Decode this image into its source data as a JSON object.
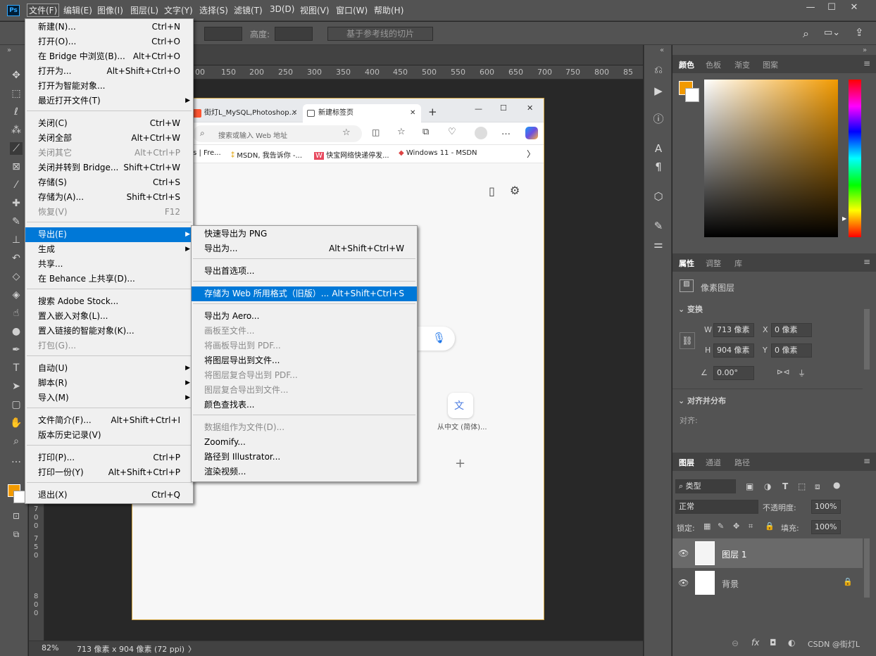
{
  "menubar": {
    "items": [
      "文件(F)",
      "编辑(E)",
      "图像(I)",
      "图层(L)",
      "文字(Y)",
      "选择(S)",
      "滤镜(T)",
      "3D(D)",
      "视图(V)",
      "窗口(W)",
      "帮助(H)"
    ],
    "win_min": "—",
    "win_max": "☐",
    "win_close": "✕"
  },
  "optbar": {
    "height_label": "高度:",
    "slice_btn": "基于参考线的切片"
  },
  "ruler": {
    "top": [
      "00",
      "150",
      "200",
      "250",
      "300",
      "350",
      "400",
      "450",
      "500",
      "550",
      "600",
      "650",
      "700",
      "750",
      "800",
      "85"
    ],
    "left": [
      "7",
      "0",
      "0",
      "7",
      "5",
      "0",
      "8",
      "0",
      "0"
    ]
  },
  "browser": {
    "tab1": "街灯L_MySQL,Photoshop...",
    "tab2": "新建标签页",
    "address_placeholder": "搜索或输入 Web 地址",
    "favs": [
      "rs | Fre...",
      "MSDN, 我告诉你 -...",
      "快宝网络快递停发...",
      "Windows 11 - MSDN"
    ],
    "translate_label": "从中文 (简体)...",
    "plus": "+",
    "win_min": "—",
    "win_max": "☐",
    "win_close": "✕"
  },
  "status": {
    "zoom": "82%",
    "doc_info": "713 像素 x 904 像素 (72 ppi)",
    "arrow": "〉"
  },
  "file_menu": {
    "items": [
      {
        "label": "新建(N)...",
        "shortcut": "Ctrl+N"
      },
      {
        "label": "打开(O)...",
        "shortcut": "Ctrl+O"
      },
      {
        "label": "在 Bridge 中浏览(B)...",
        "shortcut": "Alt+Ctrl+O"
      },
      {
        "label": "打开为...",
        "shortcut": "Alt+Shift+Ctrl+O"
      },
      {
        "label": "打开为智能对象...",
        "shortcut": ""
      },
      {
        "label": "最近打开文件(T)",
        "shortcut": ""
      },
      {
        "label": "关闭(C)",
        "shortcut": "Ctrl+W"
      },
      {
        "label": "关闭全部",
        "shortcut": "Alt+Ctrl+W"
      },
      {
        "label": "关闭其它",
        "shortcut": "Alt+Ctrl+P"
      },
      {
        "label": "关闭并转到 Bridge...",
        "shortcut": "Shift+Ctrl+W"
      },
      {
        "label": "存储(S)",
        "shortcut": "Ctrl+S"
      },
      {
        "label": "存储为(A)...",
        "shortcut": "Shift+Ctrl+S"
      },
      {
        "label": "恢复(V)",
        "shortcut": "F12"
      },
      {
        "label": "导出(E)",
        "shortcut": ""
      },
      {
        "label": "生成",
        "shortcut": ""
      },
      {
        "label": "共享...",
        "shortcut": ""
      },
      {
        "label": "在 Behance 上共享(D)...",
        "shortcut": ""
      },
      {
        "label": "搜索 Adobe Stock...",
        "shortcut": ""
      },
      {
        "label": "置入嵌入对象(L)...",
        "shortcut": ""
      },
      {
        "label": "置入链接的智能对象(K)...",
        "shortcut": ""
      },
      {
        "label": "打包(G)...",
        "shortcut": ""
      },
      {
        "label": "自动(U)",
        "shortcut": ""
      },
      {
        "label": "脚本(R)",
        "shortcut": ""
      },
      {
        "label": "导入(M)",
        "shortcut": ""
      },
      {
        "label": "文件简介(F)...",
        "shortcut": "Alt+Shift+Ctrl+I"
      },
      {
        "label": "版本历史记录(V)",
        "shortcut": ""
      },
      {
        "label": "打印(P)...",
        "shortcut": "Ctrl+P"
      },
      {
        "label": "打印一份(Y)",
        "shortcut": "Alt+Shift+Ctrl+P"
      },
      {
        "label": "退出(X)",
        "shortcut": "Ctrl+Q"
      }
    ]
  },
  "export_menu": {
    "items": [
      {
        "label": "快速导出为 PNG",
        "shortcut": ""
      },
      {
        "label": "导出为...",
        "shortcut": "Alt+Shift+Ctrl+W"
      },
      {
        "label": "导出首选项...",
        "shortcut": ""
      },
      {
        "label": "存储为 Web 所用格式（旧版）...",
        "shortcut": "Alt+Shift+Ctrl+S"
      },
      {
        "label": "导出为 Aero...",
        "shortcut": ""
      },
      {
        "label": "画板至文件...",
        "shortcut": ""
      },
      {
        "label": "将画板导出到 PDF...",
        "shortcut": ""
      },
      {
        "label": "将图层导出到文件...",
        "shortcut": ""
      },
      {
        "label": "将图层复合导出到 PDF...",
        "shortcut": ""
      },
      {
        "label": "图层复合导出到文件...",
        "shortcut": ""
      },
      {
        "label": "颜色查找表...",
        "shortcut": ""
      },
      {
        "label": "数据组作为文件(D)...",
        "shortcut": ""
      },
      {
        "label": "Zoomify...",
        "shortcut": ""
      },
      {
        "label": "路径到 Illustrator...",
        "shortcut": ""
      },
      {
        "label": "渲染视频...",
        "shortcut": ""
      }
    ]
  },
  "color_panel": {
    "tabs": [
      "颜色",
      "色板",
      "渐变",
      "图案"
    ],
    "fg": "#f29a00",
    "bg": "#ffffff"
  },
  "properties_panel": {
    "tabs": [
      "属性",
      "调整",
      "库"
    ],
    "type_label": "像素图层",
    "transform_title": "变换",
    "w_label": "W",
    "w_value": "713 像素",
    "h_label": "H",
    "h_value": "904 像素",
    "x_label": "X",
    "x_value": "0 像素",
    "y_label": "Y",
    "y_value": "0 像素",
    "angle_value": "0.00°",
    "align_title": "对齐并分布",
    "align_label": "对齐:"
  },
  "layers_panel": {
    "tabs": [
      "图层",
      "通道",
      "路径"
    ],
    "filter_label": "类型",
    "blend_mode": "正常",
    "opacity_label": "不透明度:",
    "opacity_value": "100%",
    "lock_label": "锁定:",
    "fill_label": "填充:",
    "fill_value": "100%",
    "layers": [
      {
        "name": "图层 1"
      },
      {
        "name": "背景"
      }
    ],
    "footer_text": "CSDN @街灯L"
  }
}
